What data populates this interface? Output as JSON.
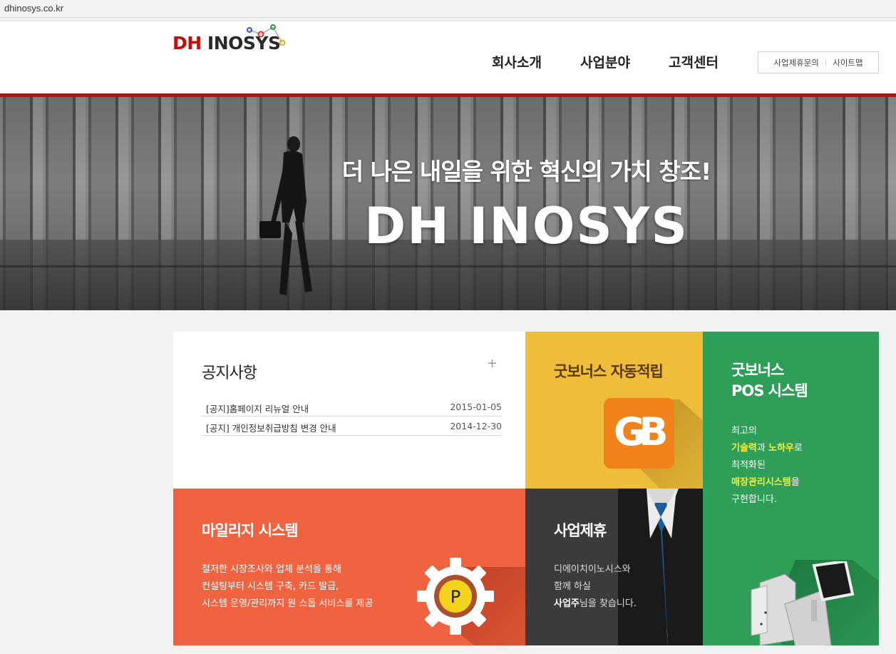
{
  "browser": {
    "url": "dhinosys.co.kr"
  },
  "header": {
    "logo_dh": "DH",
    "logo_rest": "INOSYS",
    "nav": [
      "회사소개",
      "사업분야",
      "고객센터"
    ],
    "util_links": [
      "사업제휴문의",
      "사이트맵"
    ]
  },
  "hero": {
    "subtitle": "더 나은 내일을 위한 혁신의 가치 창조!",
    "title": "DH INOSYS"
  },
  "notice": {
    "title": "공지사항",
    "more": "+",
    "items": [
      {
        "title": "[공지]홈페이지 리뉴얼 안내",
        "date": "2015-01-05"
      },
      {
        "title": "[공지] 개인정보취급방침 변경 안내",
        "date": "2014-12-30"
      }
    ]
  },
  "goodbonus": {
    "title": "굿보너스 자동적립",
    "icon_text": "GB"
  },
  "pos": {
    "title_line1": "굿보너스",
    "title_line2": "POS 시스템",
    "line1": "최고의",
    "line2_hl1": "기술력",
    "line2_mid": "과 ",
    "line2_hl2": "노하우",
    "line2_end": "로",
    "line3": "최적화된",
    "line4_hl": "매장관리시스템",
    "line4_end": "을",
    "line5": "구현합니다."
  },
  "mileage": {
    "title": "마일리지 시스템",
    "lines": [
      "철저한 시장조사와 업체 분석을 통해",
      "컨설팅부터 시스템 구축, 카드 발급,",
      "시스템 운영/관리까지 원 스톱 서비스를 제공"
    ],
    "icon_text": "P"
  },
  "partnership": {
    "title": "사업제휴",
    "line1": "디에이치이노시스와",
    "line2": "함께 하실",
    "line3_bold": "사업주",
    "line3_end": "님을 찾습니다."
  },
  "colors": {
    "brand_red": "#c00d0d",
    "yellow": "#eebe3a",
    "green": "#2f9e59",
    "orange": "#ef6341",
    "dark": "#3b3b3b"
  }
}
